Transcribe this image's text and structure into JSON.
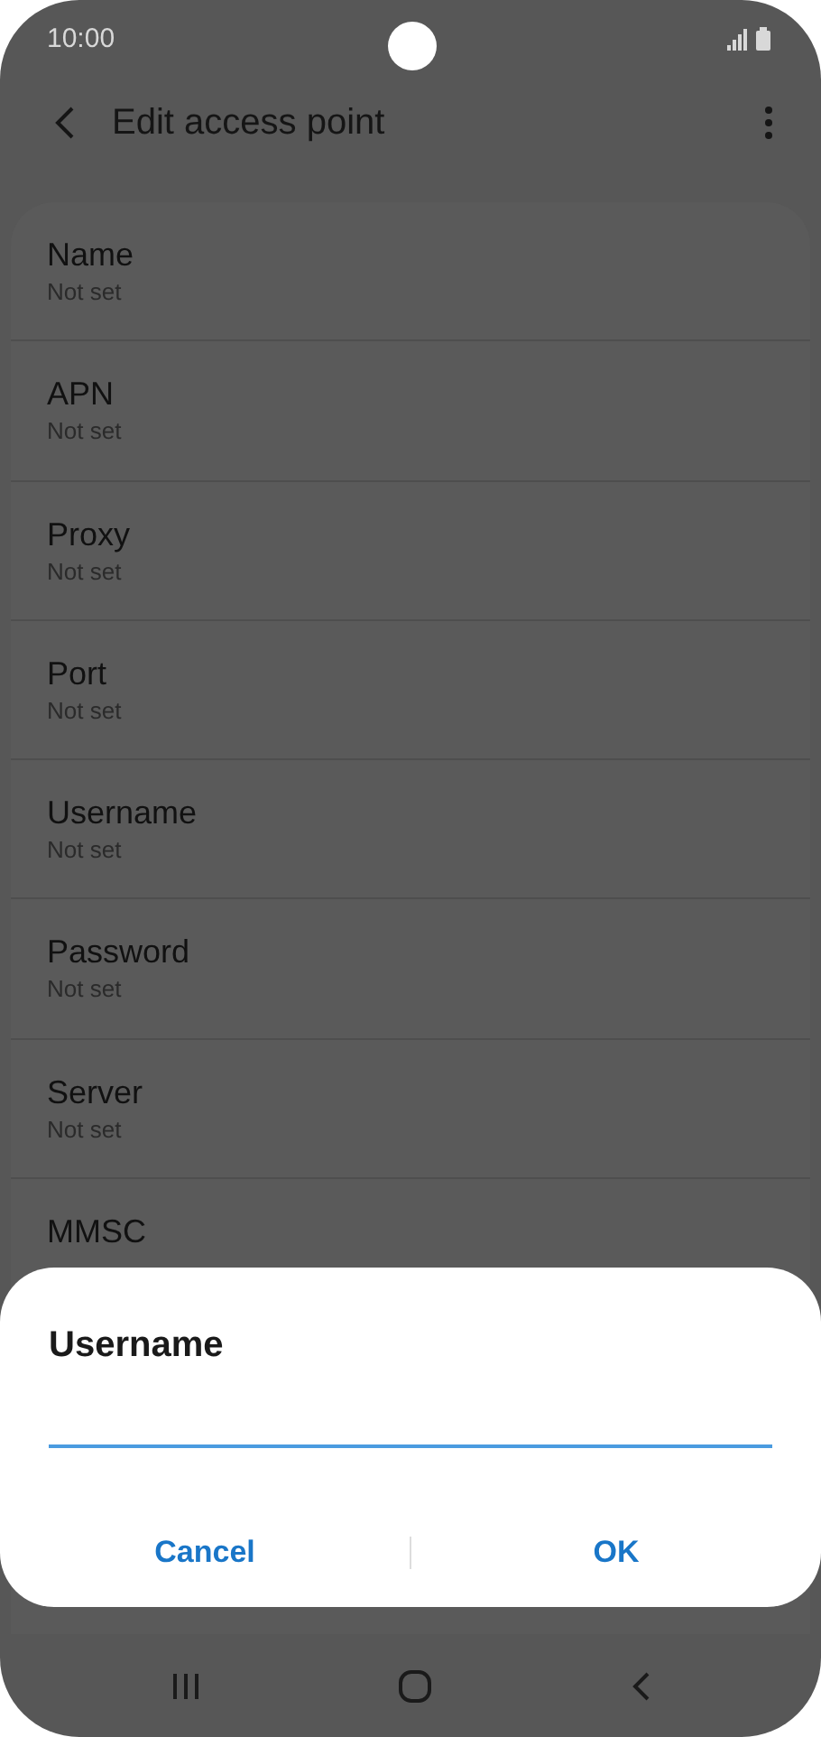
{
  "status_bar": {
    "time": "10:00"
  },
  "header": {
    "title": "Edit access point"
  },
  "fields": [
    {
      "label": "Name",
      "value": "Not set"
    },
    {
      "label": "APN",
      "value": "Not set"
    },
    {
      "label": "Proxy",
      "value": "Not set"
    },
    {
      "label": "Port",
      "value": "Not set"
    },
    {
      "label": "Username",
      "value": "Not set"
    },
    {
      "label": "Password",
      "value": "Not set"
    },
    {
      "label": "Server",
      "value": "Not set"
    },
    {
      "label": "MMSC"
    }
  ],
  "dialog": {
    "title": "Username",
    "buttons": [
      "Cancel",
      "OK"
    ]
  }
}
